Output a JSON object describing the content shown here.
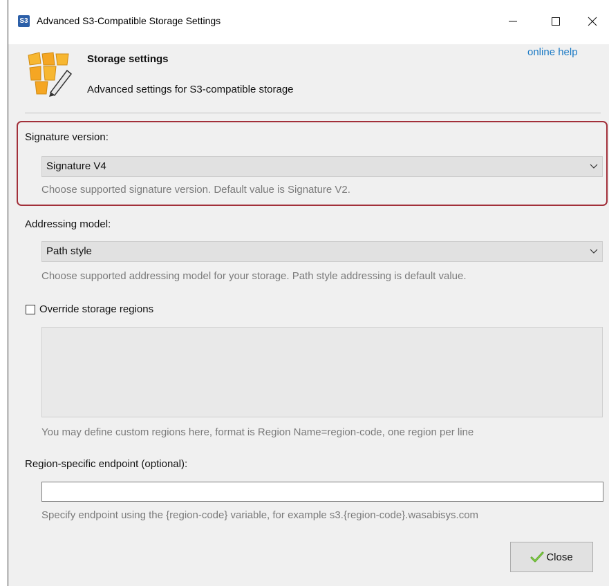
{
  "window": {
    "app_icon_text": "S3",
    "title": "Advanced S3-Compatible Storage Settings"
  },
  "header": {
    "title": "Storage settings",
    "subtitle": "Advanced settings for S3-compatible storage",
    "online_help": "online help"
  },
  "signature": {
    "label": "Signature version:",
    "value": "Signature V4",
    "hint": "Choose supported signature version. Default value is Signature V2."
  },
  "addressing": {
    "label": "Addressing model:",
    "value": "Path style",
    "hint": "Choose supported addressing model for your storage. Path style addressing is default value."
  },
  "regions": {
    "checkbox_label": "Override storage regions",
    "checked": false,
    "text": "",
    "hint": "You may define custom regions here, format is Region Name=region-code, one region per line"
  },
  "endpoint": {
    "label": "Region-specific endpoint (optional):",
    "value": "",
    "hint": "Specify endpoint using the {region-code} variable, for example s3.{region-code}.wasabisys.com"
  },
  "footer": {
    "close_label": "Close"
  },
  "colors": {
    "accent_link": "#1a79c4",
    "highlight_border": "#a2303a",
    "bucket_orange": "#f5a623"
  }
}
